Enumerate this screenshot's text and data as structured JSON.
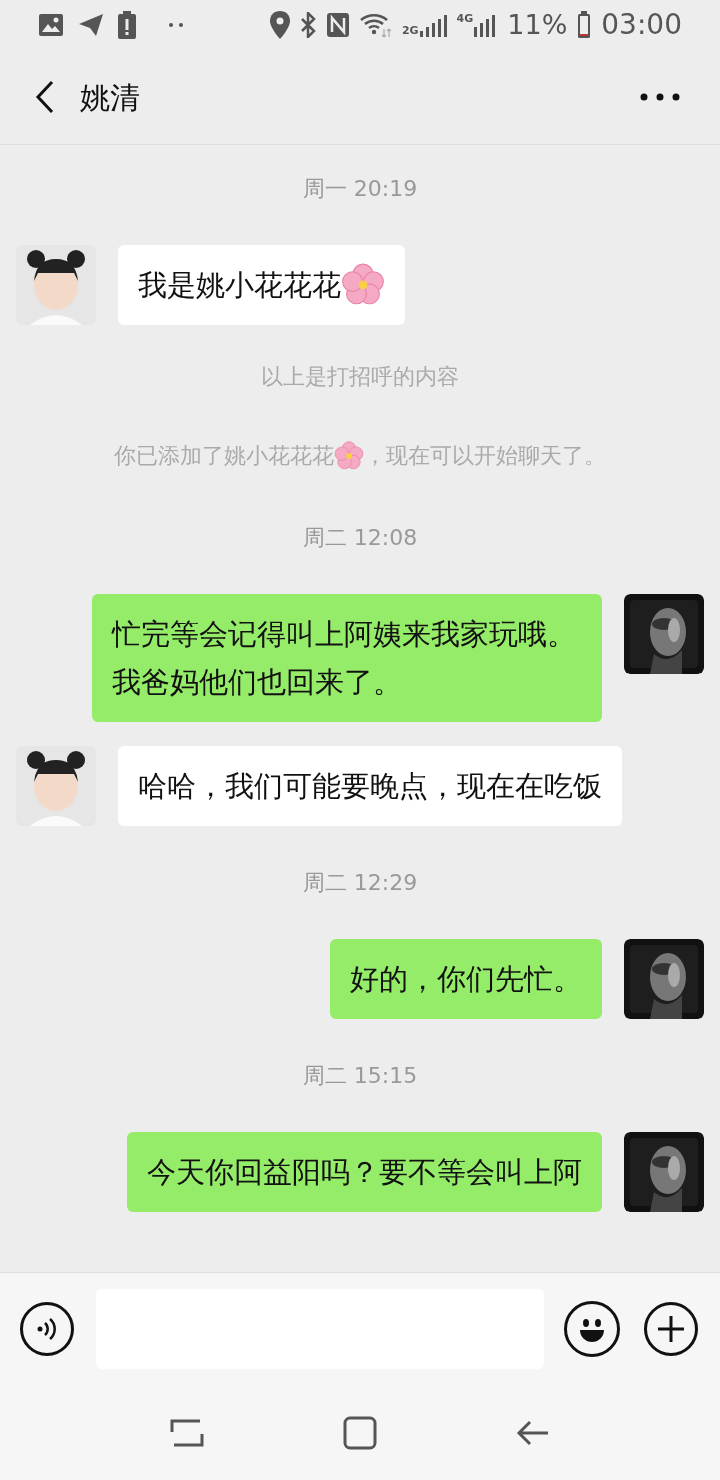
{
  "status_bar": {
    "network_2g": "2G",
    "network_4g": "4G",
    "battery": "11%",
    "time": "03:00"
  },
  "header": {
    "title": "姚清"
  },
  "messages": [
    {
      "kind": "time",
      "text": "周一 20:19"
    },
    {
      "kind": "incoming",
      "text": "我是姚小花花花",
      "flower": true
    },
    {
      "kind": "system",
      "text": "以上是打招呼的内容",
      "flower": false
    },
    {
      "kind": "system",
      "text": "你已添加了姚小花花花",
      "flower": true,
      "text_after": "，现在可以开始聊天了。"
    },
    {
      "kind": "time",
      "text": "周二 12:08"
    },
    {
      "kind": "outgoing",
      "text": "忙完等会记得叫上阿姨来我家玩哦。我爸妈他们也回来了。",
      "flower": false
    },
    {
      "kind": "incoming",
      "text": "哈哈，我们可能要晚点，现在在吃饭",
      "flower": false
    },
    {
      "kind": "time",
      "text": "周二 12:29"
    },
    {
      "kind": "outgoing",
      "text": "好的，你们先忙。",
      "flower": false
    },
    {
      "kind": "time",
      "text": "周二 15:15"
    },
    {
      "kind": "outgoing",
      "text": "今天你回益阳吗？要不等会叫上阿",
      "flower": false
    }
  ]
}
